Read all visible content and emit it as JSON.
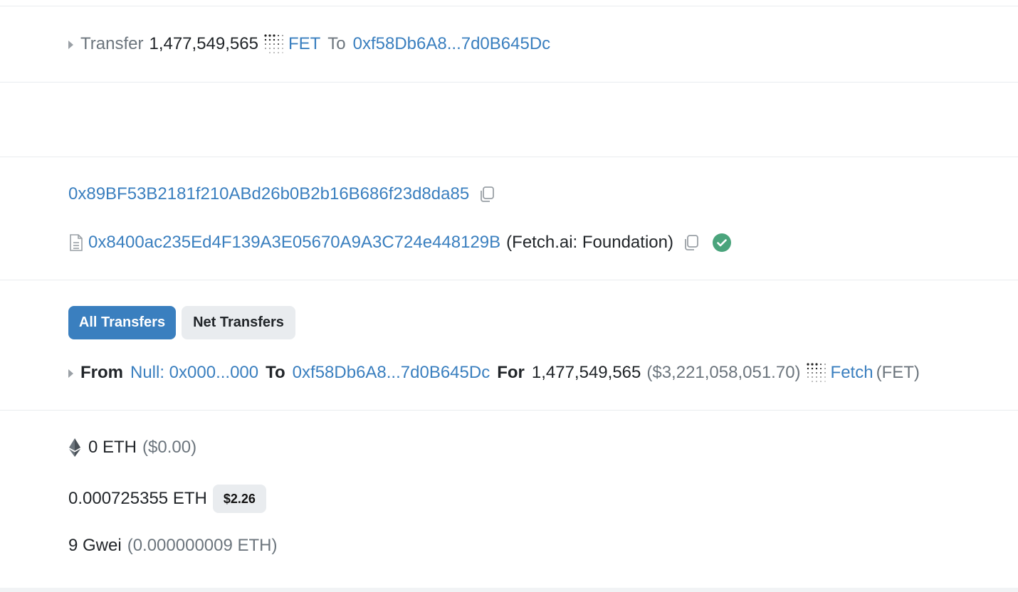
{
  "transfer_summary": {
    "label": "Transfer",
    "amount": "1,477,549,565",
    "token_symbol": "FET",
    "to_label": "To",
    "to_address": "0xf58Db6A8...7d0B645Dc"
  },
  "from_address": "0x89BF53B2181f210ABd26b0B2b16B686f23d8da85",
  "contract": {
    "address": "0x8400ac235Ed4F139A3E05670A9A3C724e448129B",
    "name": "(Fetch.ai: Foundation)"
  },
  "tabs": {
    "all": "All Transfers",
    "net": "Net Transfers"
  },
  "token_transfer": {
    "from_label": "From",
    "from_address": "Null: 0x000...000",
    "to_label": "To",
    "to_address": "0xf58Db6A8...7d0B645Dc",
    "for_label": "For",
    "amount": "1,477,549,565",
    "usd_value": "($3,221,058,051.70)",
    "token_name": "Fetch",
    "token_symbol": "(FET)"
  },
  "value": {
    "amount": "0 ETH",
    "usd": "($0.00)"
  },
  "fee": {
    "amount": "0.000725355 ETH",
    "usd_badge": "$2.26"
  },
  "gas_price": {
    "amount": "9 Gwei",
    "eth": "(0.000000009 ETH)"
  },
  "colors": {
    "link": "#3a7fbf",
    "success": "#4aa47c",
    "muted": "#6c757d"
  }
}
